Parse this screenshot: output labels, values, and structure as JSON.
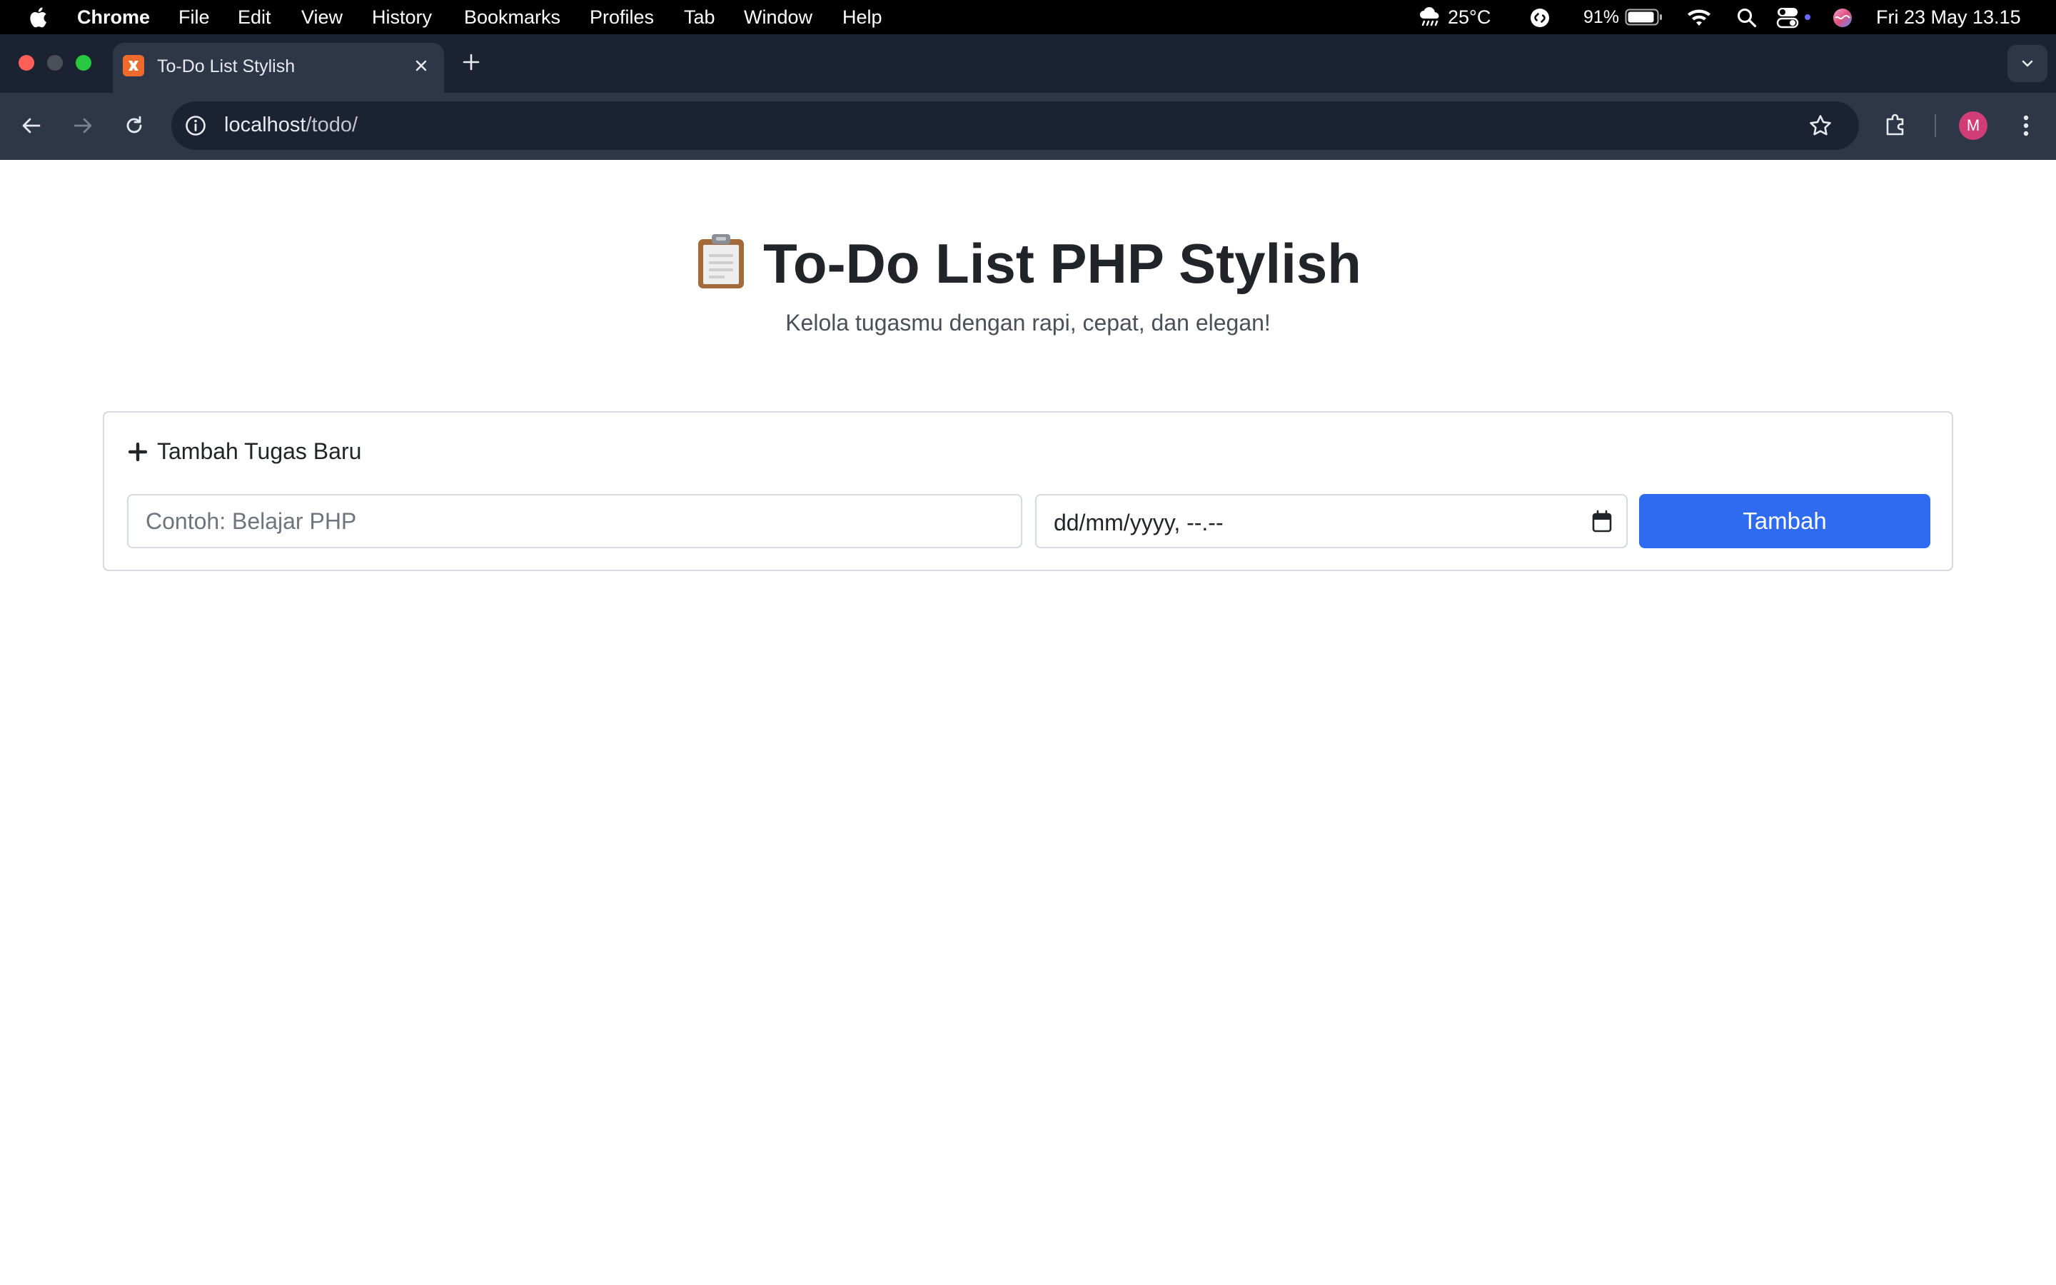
{
  "menubar": {
    "app_name": "Chrome",
    "items": [
      "File",
      "Edit",
      "View",
      "History",
      "Bookmarks",
      "Profiles",
      "Tab",
      "Window",
      "Help"
    ],
    "weather": "25°C",
    "battery": "91%",
    "datetime": "Fri 23 May  13.15"
  },
  "browser": {
    "tab_title": "To-Do List Stylish",
    "url_host": "localhost",
    "url_path": "/todo/",
    "profile_initial": "M"
  },
  "page": {
    "title": "To-Do List PHP Stylish",
    "subtitle": "Kelola tugasmu dengan rapi, cepat, dan elegan!",
    "form": {
      "section_title": "Tambah Tugas Baru",
      "task_placeholder": "Contoh: Belajar PHP",
      "task_value": "",
      "date_placeholder": "dd/mm/yyyy, --.--",
      "submit_label": "Tambah"
    }
  },
  "colors": {
    "accent": "#2f6bf0",
    "tab_strip": "#1b2332",
    "toolbar": "#2d3748",
    "avatar": "#d23d76",
    "favicon": "#f06a2c"
  }
}
